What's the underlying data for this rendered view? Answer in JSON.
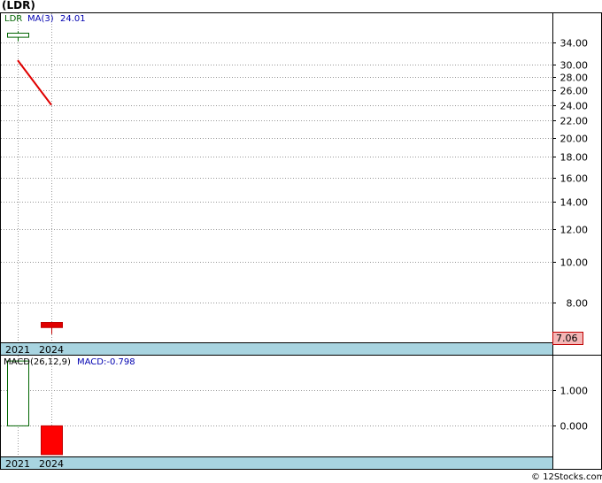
{
  "chart_data": [
    {
      "type": "candlestick",
      "title": "(LDR)",
      "legend": {
        "symbol": "LDR",
        "ma_label": "MA(3)",
        "ma_value": "24.01"
      },
      "ylim": [
        6.4,
        40.0
      ],
      "log_scale": true,
      "y_ticks": [
        "34.00",
        "30.00",
        "28.00",
        "26.00",
        "24.00",
        "22.00",
        "20.00",
        "18.00",
        "16.00",
        "14.00",
        "12.00",
        "10.00",
        "8.00"
      ],
      "x_labels": [
        "2021",
        "2024"
      ],
      "candles": [
        {
          "year": "2021",
          "open": 35.0,
          "close": 35.8,
          "high": 36.2,
          "low": 34.2,
          "direction": "up"
        },
        {
          "year": "2024",
          "open": 7.15,
          "close": 6.95,
          "high": 7.15,
          "low": 6.7,
          "direction": "down"
        }
      ],
      "ma_series": {
        "name": "MA(3)",
        "x": [
          "2021",
          "2024"
        ],
        "values": [
          30.8,
          24.01
        ]
      },
      "last_price": "7.06",
      "grid": true
    },
    {
      "type": "bar",
      "legend": {
        "name": "MACD(26,12,9)",
        "value_label": "MACD:-0.798"
      },
      "categories": [
        "2021",
        "2024"
      ],
      "values": [
        1.8,
        -0.798
      ],
      "ylim": [
        -0.85,
        1.95
      ],
      "y_ticks": [
        "1.000",
        "0.000"
      ],
      "grid": true
    }
  ],
  "footer": "© 12Stocks.com"
}
